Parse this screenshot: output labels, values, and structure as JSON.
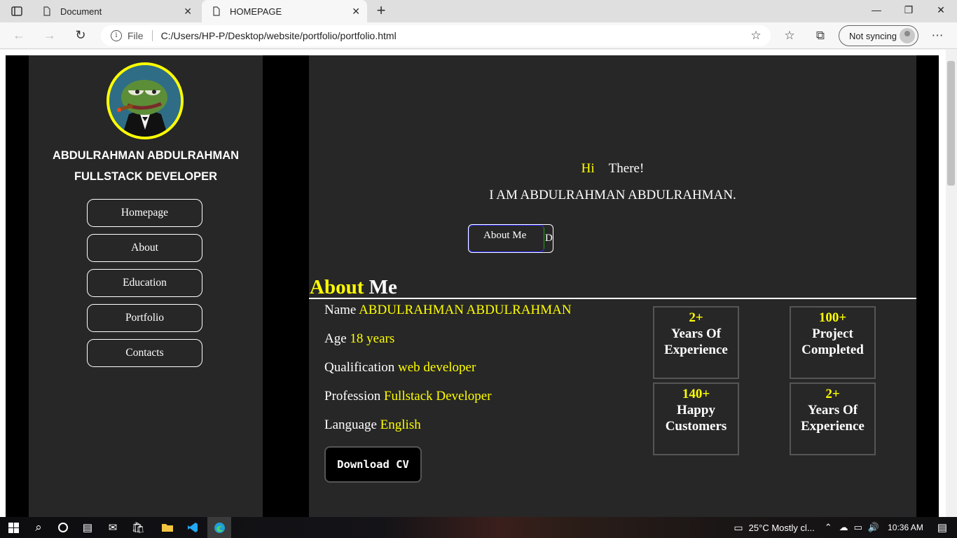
{
  "browser": {
    "tabs": [
      {
        "title": "Document",
        "active": false
      },
      {
        "title": "HOMEPAGE",
        "active": true
      }
    ],
    "address": {
      "scheme_label": "File",
      "url": "C:/Users/HP-P/Desktop/website/portfolio/portfolio.html"
    },
    "sync_label": "Not syncing"
  },
  "sidebar": {
    "name": "ABDULRAHMAN ABDULRAHMAN",
    "role": "FULLSTACK DEVELOPER",
    "nav": [
      {
        "label": "Homepage"
      },
      {
        "label": "About"
      },
      {
        "label": "Education"
      },
      {
        "label": "Portfolio"
      },
      {
        "label": "Contacts"
      }
    ]
  },
  "hero": {
    "hi": "Hi",
    "there": "There!",
    "intro": "I AM ABDULRAHMAN ABDULRAHMAN.",
    "button_label": "About Me",
    "button_extra": "D"
  },
  "about": {
    "title_highlight": "About",
    "title_rest": "Me",
    "info": [
      {
        "label": "Name",
        "value": "ABDULRAHMAN ABDULRAHMAN"
      },
      {
        "label": "Age",
        "value": "18 years"
      },
      {
        "label": "Qualification",
        "value": "web developer"
      },
      {
        "label": "Profession",
        "value": "Fullstack Developer"
      },
      {
        "label": "Language",
        "value": "English"
      }
    ],
    "download_label": "Download CV",
    "stats": [
      {
        "number": "2+",
        "line1": "Years Of",
        "line2": "Experience"
      },
      {
        "number": "100+",
        "line1": "Project",
        "line2": "Completed"
      },
      {
        "number": "140+",
        "line1": "Happy",
        "line2": "Customers"
      },
      {
        "number": "2+",
        "line1": "Years Of",
        "line2": "Experience"
      }
    ]
  },
  "taskbar": {
    "weather": "25°C  Mostly cl...",
    "time": "10:36 AM"
  },
  "colors": {
    "accent": "#ffff00",
    "panel": "#272727",
    "page_bg": "#000000"
  }
}
